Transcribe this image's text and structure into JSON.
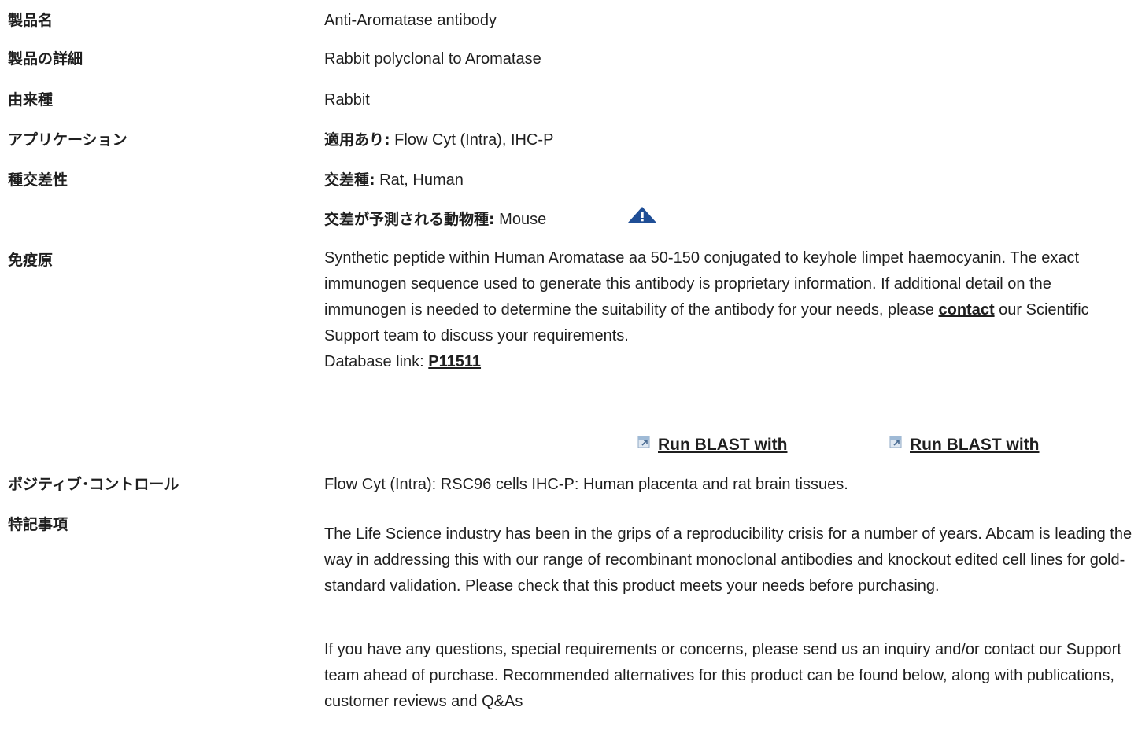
{
  "rows": {
    "product_name": {
      "label": "製品名",
      "value": "Anti-Aromatase antibody"
    },
    "product_detail": {
      "label": "製品の詳細",
      "value": "Rabbit polyclonal to Aromatase"
    },
    "host_species": {
      "label": "由来種",
      "value": "Rabbit"
    },
    "applications": {
      "label": "アプリケーション",
      "prefix": "適用あり:",
      "value": " Flow Cyt (Intra), IHC-P"
    },
    "reactivity": {
      "label": "種交差性",
      "reacts_prefix": "交差種:",
      "reacts_value": " Rat, Human",
      "predicted_prefix": "交差が予測される動物種:",
      "predicted_value": " Mouse",
      "warning_icon": "warning-triangle-icon",
      "warning_color": "#1f4e96"
    },
    "immunogen": {
      "label": "免疫原",
      "text_before_link": "Synthetic peptide within Human Aromatase aa 50-150 conjugated to keyhole limpet haemocyanin. The exact immunogen sequence used to generate this antibody is proprietary information. If additional detail on the immunogen is needed to determine the suitability of the antibody for your needs, please ",
      "contact_link": "contact",
      "text_after_link": " our Scientific Support team to discuss your requirements.",
      "database_label": "Database link: ",
      "database_link": "P11511",
      "blast_1": "Run BLAST with",
      "blast_2": "Run BLAST with"
    },
    "positive_control": {
      "label": "ポジティブ･コントロール",
      "value": "Flow Cyt (Intra): RSC96 cells IHC-P: Human placenta and rat brain tissues."
    },
    "notes": {
      "label": "特記事項",
      "para_1": "The Life Science industry has been in the grips of a reproducibility crisis for a number of years. Abcam is leading the way in addressing this with our range of recombinant monoclonal antibodies and knockout edited cell lines for gold-standard validation. Please check that this product meets your needs before purchasing.",
      "para_2": "If you have any questions, special requirements or concerns, please send us an inquiry and/or contact our Support team ahead of purchase. Recommended alternatives for this product can be found below, along with publications, customer reviews and Q&As"
    }
  }
}
